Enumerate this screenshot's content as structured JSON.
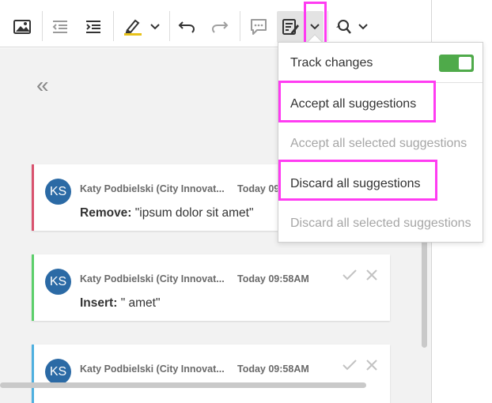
{
  "toolbar": {
    "icons": [
      "image-icon",
      "outdent-icon",
      "indent-icon",
      "highlight-icon",
      "chevron-down-icon",
      "undo-icon",
      "redo-icon",
      "comment-icon",
      "track-changes-icon",
      "chevron-down-icon",
      "find-replace-icon",
      "chevron-down-icon"
    ]
  },
  "sidebar": {
    "collapse_label": "«"
  },
  "suggestions": [
    {
      "initials": "KS",
      "author": "Katy Podbielski (City Innovat...",
      "time": "Today 09",
      "type_label": "Remove:",
      "content": "\"ipsum dolor sit amet\"",
      "accent": "#d9536f"
    },
    {
      "initials": "KS",
      "author": "Katy Podbielski (City Innovat...",
      "time": "Today 09:58AM",
      "type_label": "Insert:",
      "content": "\" amet\"",
      "accent": "#5ccf6b"
    },
    {
      "initials": "KS",
      "author": "Katy Podbielski (City Innovat...",
      "time": "Today 09:58AM",
      "type_label": "",
      "content": "",
      "accent": "#4fb0e0"
    }
  ],
  "track_menu": {
    "track_changes_label": "Track changes",
    "track_changes_enabled": true,
    "accept_all": "Accept all suggestions",
    "accept_selected": "Accept all selected suggestions",
    "discard_all": "Discard all suggestions",
    "discard_selected": "Discard all selected suggestions"
  },
  "colors": {
    "highlight": "#ff3cf2",
    "toggle_on": "#4faa4a",
    "avatar": "#2b6aa5"
  }
}
